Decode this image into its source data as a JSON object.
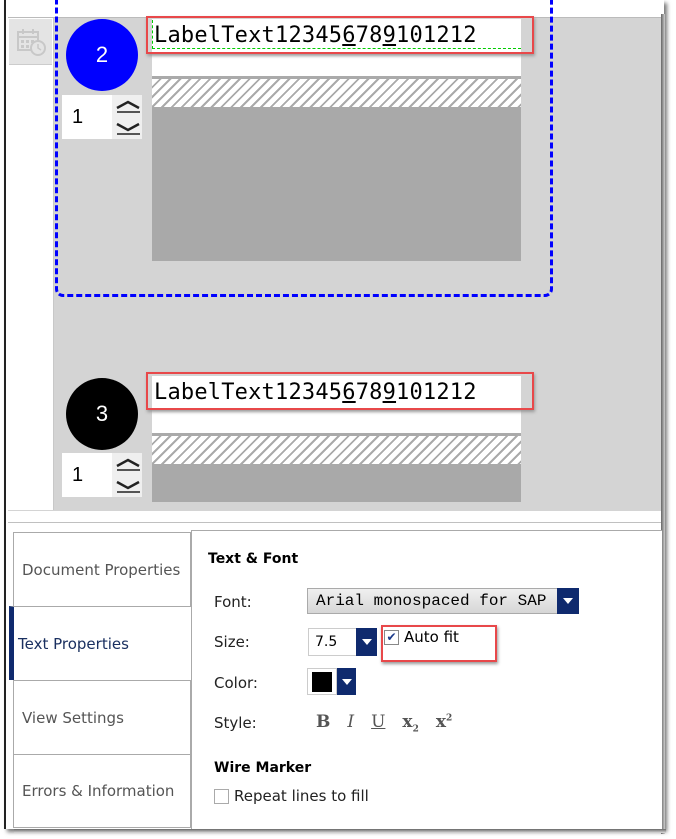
{
  "canvas": {
    "toolbar": {
      "calendar_icon": "calendar-clock-icon"
    },
    "labels": [
      {
        "number": "2",
        "color": "#0000ff",
        "quantity": "1",
        "text_parts": [
          "LabelText12345",
          "6",
          "78",
          "9",
          "101212"
        ],
        "selected": true
      },
      {
        "number": "3",
        "color": "#000000",
        "quantity": "1",
        "text_parts": [
          "LabelText12345",
          "6",
          "78",
          "9",
          "101212"
        ],
        "selected": false
      }
    ],
    "highlight_color": "#e8484a",
    "selection_color": "#0000ff"
  },
  "tabs": [
    {
      "label": "Document Properties",
      "active": false
    },
    {
      "label": "Text Properties",
      "active": true
    },
    {
      "label": "View Settings",
      "active": false
    },
    {
      "label": "Errors & Information",
      "active": false
    }
  ],
  "panel": {
    "section_text_font": "Text & Font",
    "font_label": "Font:",
    "font_value": "Arial monospaced for SAP",
    "size_label": "Size:",
    "size_value": "7.5",
    "auto_fit_label": "Auto fit",
    "auto_fit_checked": true,
    "color_label": "Color:",
    "color_value": "#000000",
    "style_label": "Style:",
    "style_buttons": {
      "bold": "B",
      "italic": "I",
      "underline": "U",
      "subscript": "x",
      "subscript_mark": "2",
      "superscript": "x",
      "superscript_mark": "2"
    },
    "section_wire_marker": "Wire Marker",
    "repeat_lines_label": "Repeat lines to fill",
    "repeat_lines_checked": false,
    "accent_color": "#0f2a6e"
  }
}
